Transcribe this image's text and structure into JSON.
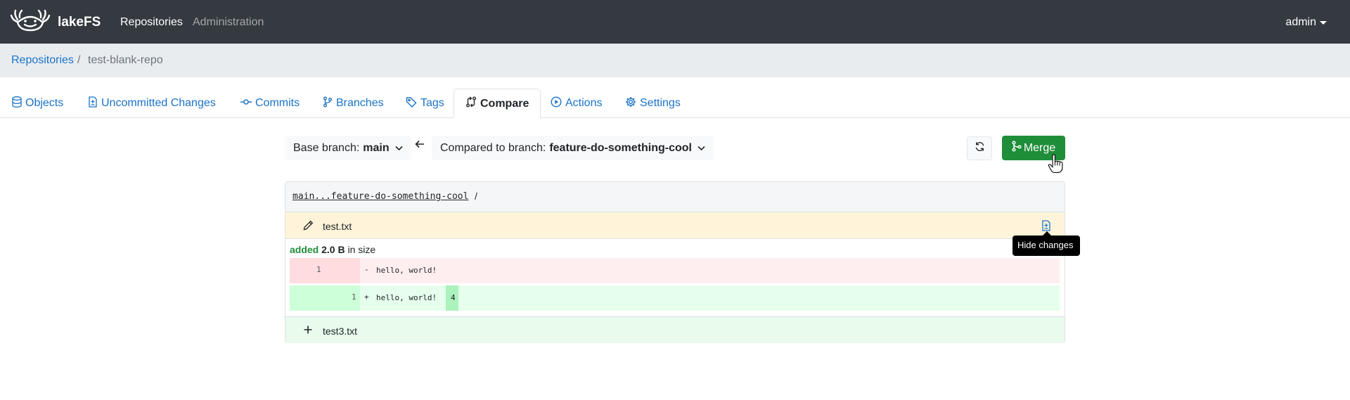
{
  "navbar": {
    "brand": "lakeFS",
    "links": [
      "Repositories",
      "Administration"
    ],
    "user": "admin"
  },
  "breadcrumb": {
    "root": "Repositories",
    "separator": "/",
    "current": "test-blank-repo"
  },
  "tabs": [
    {
      "label": "Objects",
      "icon": "database-icon"
    },
    {
      "label": "Uncommitted Changes",
      "icon": "file-diff-icon"
    },
    {
      "label": "Commits",
      "icon": "commit-icon"
    },
    {
      "label": "Branches",
      "icon": "branch-icon"
    },
    {
      "label": "Tags",
      "icon": "tag-icon"
    },
    {
      "label": "Compare",
      "icon": "compare-icon",
      "active": true
    },
    {
      "label": "Actions",
      "icon": "play-icon"
    },
    {
      "label": "Settings",
      "icon": "gear-icon"
    }
  ],
  "compare": {
    "base_label": "Base branch:",
    "base_branch": "main",
    "compared_label": "Compared to branch:",
    "compared_branch": "feature-do-something-cool",
    "merge_label": "Merge"
  },
  "diff": {
    "ref": "main...feature-do-something-cool",
    "ref_suffix": "/",
    "changed_file": "test.txt",
    "size_change": {
      "verb": "added",
      "amount": "2.0 B",
      "suffix": "in size"
    },
    "lines": [
      {
        "type": "del",
        "num": "1",
        "sign": "-",
        "text": "hello, world!"
      },
      {
        "type": "ins",
        "num": "1",
        "sign": "+",
        "text": "hello, world!",
        "highlight": "4"
      }
    ],
    "added_file": "test3.txt",
    "tooltip": "Hide changes"
  },
  "colors": {
    "navbar": "#343a40",
    "link": "#1a73c8",
    "merge": "#1f8e3a",
    "changed_row": "#fff4d9",
    "added_row": "#e8fbec"
  }
}
